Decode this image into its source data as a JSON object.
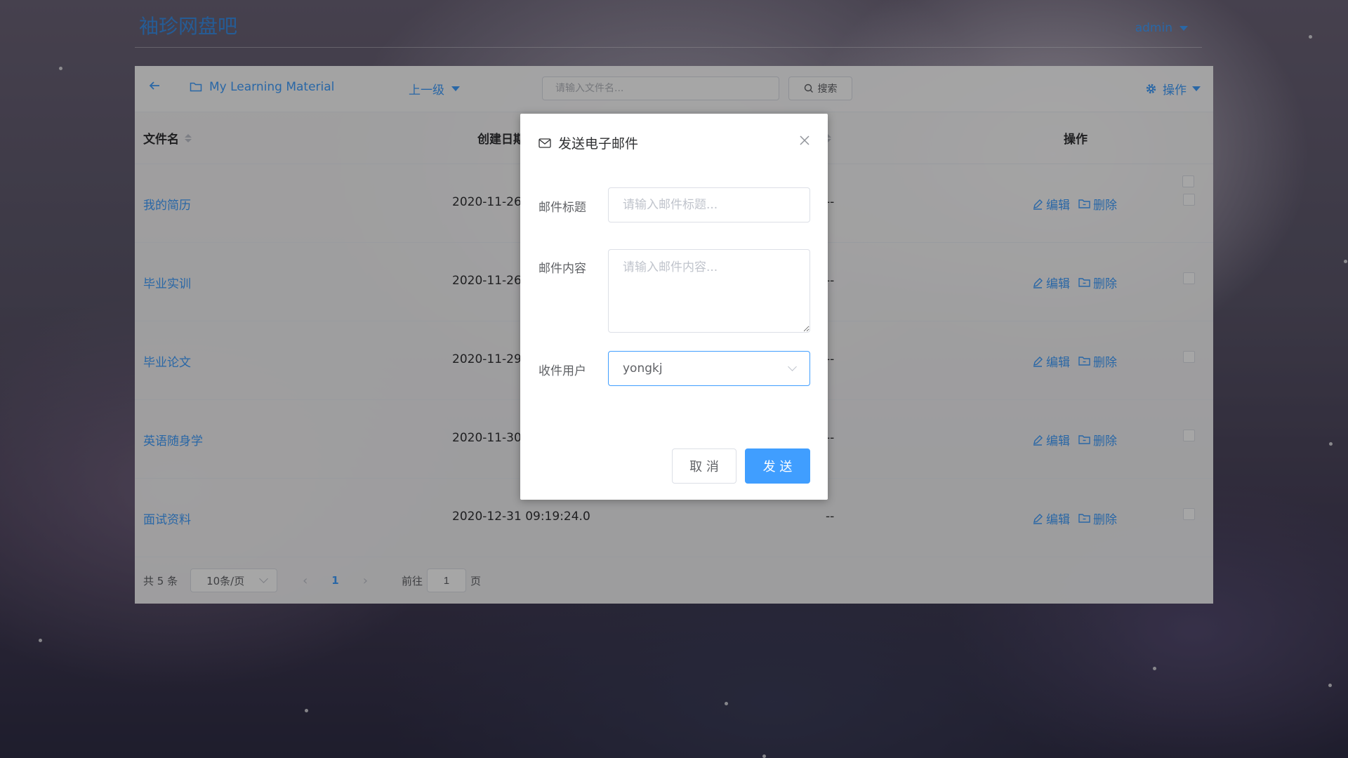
{
  "app": {
    "logo": "袖珍网盘吧",
    "user": "admin"
  },
  "toolbar": {
    "back_icon": "arrow-left-icon",
    "folder_name": "My Learning Material",
    "up_level": "上一级",
    "search_placeholder": "请输入文件名...",
    "search_label": "搜索",
    "ops_label": "操作"
  },
  "table": {
    "headers": {
      "name": "文件名",
      "created": "创建日期",
      "size": "大小",
      "ops": "操作"
    },
    "rows": [
      {
        "name": "我的简历",
        "created": "2020-11-26 ",
        "size": "--",
        "edit": "编辑",
        "delete": "删除"
      },
      {
        "name": "毕业实训",
        "created": "2020-11-26 ",
        "size": "--",
        "edit": "编辑",
        "delete": "删除"
      },
      {
        "name": "毕业论文",
        "created": "2020-11-29 ",
        "size": "--",
        "edit": "编辑",
        "delete": "删除"
      },
      {
        "name": "英语随身学",
        "created": "2020-11-30 ",
        "size": "--",
        "edit": "编辑",
        "delete": "删除"
      },
      {
        "name": "面试资料",
        "created": "2020-12-31 09:19:24.0",
        "size": "--",
        "edit": "编辑",
        "delete": "删除"
      }
    ]
  },
  "pagination": {
    "total": "共 5 条",
    "page_size": "10条/页",
    "current_page": "1",
    "goto_label": "前往",
    "goto_value": "1",
    "page_unit": "页"
  },
  "dialog": {
    "title": "发送电子邮件",
    "subject_label": "邮件标题",
    "subject_placeholder": "请输入邮件标题...",
    "content_label": "邮件内容",
    "content_placeholder": "请输入邮件内容...",
    "recipient_label": "收件用户",
    "recipient_value": "yongkj",
    "cancel_label": "取 消",
    "send_label": "发 送"
  },
  "colors": {
    "accent": "#409eff",
    "text": "#303133",
    "muted": "#606266"
  }
}
